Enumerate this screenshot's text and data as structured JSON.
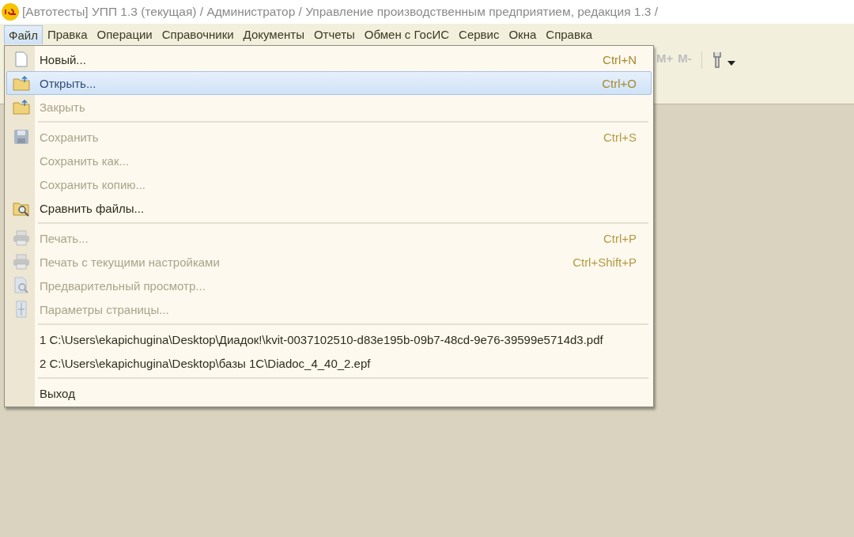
{
  "window": {
    "title": "[Автотесты] УПП 1.3 (текущая) / Администратор /  Управление производственным предприятием, редакция 1.3 /"
  },
  "menu_bar": [
    {
      "label": "Файл",
      "selected": true
    },
    {
      "label": "Правка",
      "selected": false
    },
    {
      "label": "Операции",
      "selected": false
    },
    {
      "label": "Справочники",
      "selected": false
    },
    {
      "label": "Документы",
      "selected": false
    },
    {
      "label": "Отчеты",
      "selected": false
    },
    {
      "label": "Обмен с ГосИС",
      "selected": false
    },
    {
      "label": "Сервис",
      "selected": false
    },
    {
      "label": "Окна",
      "selected": false
    },
    {
      "label": "Справка",
      "selected": false
    }
  ],
  "toolbar": {
    "buttons": [
      {
        "label": "M+",
        "disabled": true
      },
      {
        "label": "M-",
        "disabled": true
      }
    ]
  },
  "file_menu": [
    {
      "kind": "item",
      "label": "Новый...",
      "shortcut": "Ctrl+N",
      "disabled": false,
      "selected": false
    },
    {
      "kind": "item",
      "label": "Открыть...",
      "shortcut": "Ctrl+O",
      "disabled": false,
      "selected": true
    },
    {
      "kind": "item",
      "label": "Закрыть",
      "disabled": true,
      "selected": false
    },
    {
      "kind": "separator"
    },
    {
      "kind": "item",
      "label": "Сохранить",
      "shortcut": "Ctrl+S",
      "disabled": true,
      "selected": false
    },
    {
      "kind": "item",
      "label": "Сохранить как...",
      "disabled": true,
      "selected": false
    },
    {
      "kind": "item",
      "label": "Сохранить копию...",
      "disabled": true,
      "selected": false
    },
    {
      "kind": "item",
      "label": "Сравнить файлы...",
      "disabled": false,
      "selected": false
    },
    {
      "kind": "separator"
    },
    {
      "kind": "item",
      "label": "Печать...",
      "shortcut": "Ctrl+P",
      "disabled": true,
      "selected": false
    },
    {
      "kind": "item",
      "label": "Печать с текущими настройками",
      "shortcut": "Ctrl+Shift+P",
      "disabled": true,
      "selected": false
    },
    {
      "kind": "item",
      "label": "Предварительный просмотр...",
      "disabled": true,
      "selected": false
    },
    {
      "kind": "item",
      "label": "Параметры страницы...",
      "disabled": true,
      "selected": false
    },
    {
      "kind": "separator"
    },
    {
      "kind": "item",
      "label": "1 C:\\Users\\ekapichugina\\Desktop\\Диадок!\\kvit-0037102510-d83e195b-09b7-48cd-9e76-39599e5714d3.pdf",
      "disabled": false,
      "selected": false
    },
    {
      "kind": "item",
      "label": "2 C:\\Users\\ekapichugina\\Desktop\\базы 1C\\Diadoc_4_40_2.epf",
      "disabled": false,
      "selected": false
    },
    {
      "kind": "separator"
    },
    {
      "kind": "item",
      "label": "Выход",
      "disabled": false,
      "selected": false
    }
  ]
}
